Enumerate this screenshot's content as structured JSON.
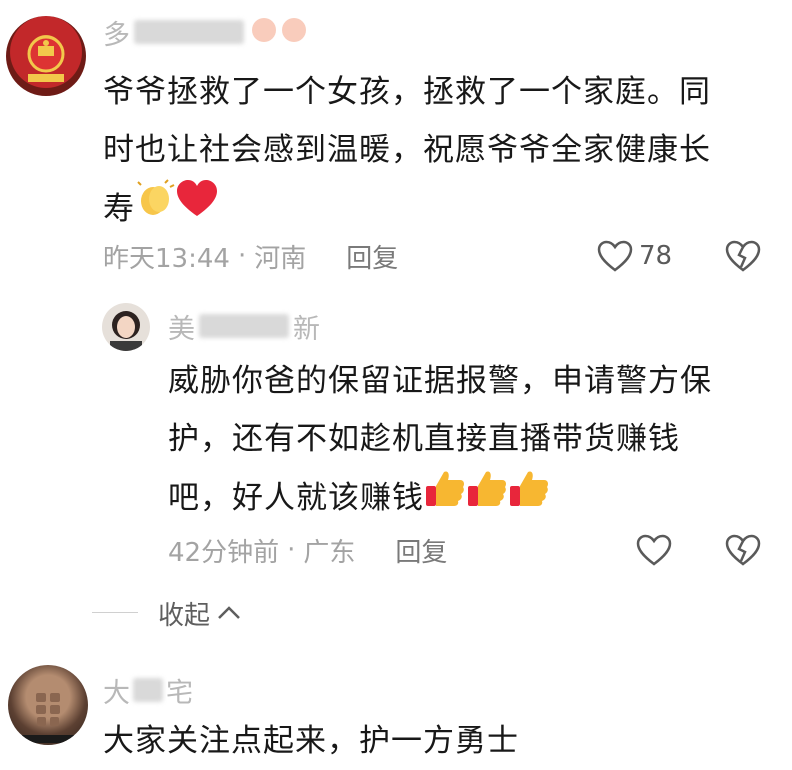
{
  "comments": [
    {
      "username_visible": "多",
      "text_lines": [
        "爷爷拯救了一个女孩，拯救了一个家庭。同",
        "时也让社会感到温暖，祝愿爷爷全家健康长",
        "寿"
      ],
      "time": "昨天13:44",
      "separator": "·",
      "location": "河南",
      "reply_label": "回复",
      "like_count": "78"
    },
    {
      "username_visible_start": "美",
      "username_visible_end": "新",
      "text_lines": [
        "威胁你爸的保留证据报警，申请警方保",
        "护，还有不如趁机直接直播带货赚钱",
        "吧，好人就该赚钱"
      ],
      "time": "42分钟前",
      "separator": "·",
      "location": "广东",
      "reply_label": "回复"
    },
    {
      "username_visible_start": "大",
      "username_visible_end": "宅",
      "text_lines": [
        "大家关注点起来，护一方勇士"
      ]
    }
  ],
  "collapse_label": "收起",
  "colors": {
    "meta": "#a3a3a3",
    "text": "#181818",
    "heart_red": "#e8263b",
    "thumb_yellow": "#f7b731"
  },
  "icons": [
    "heart-outline-icon",
    "broken-heart-icon",
    "chevron-up-icon",
    "clap-emoji",
    "red-heart-emoji",
    "thumbs-up-emoji"
  ]
}
